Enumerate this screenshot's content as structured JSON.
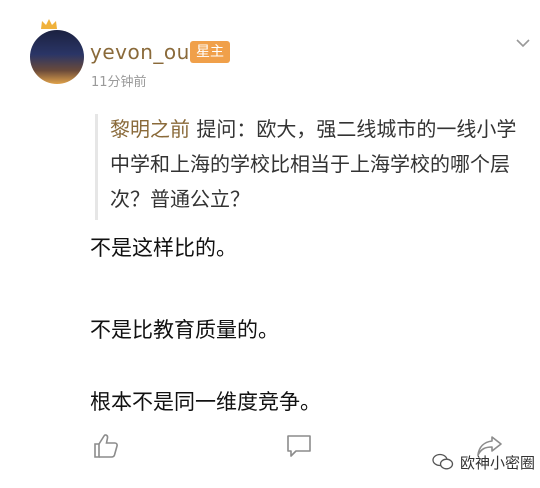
{
  "author": {
    "username": "yevon_ou",
    "badge": "星主",
    "timestamp": "11分钟前"
  },
  "quote": {
    "author": "黎明之前",
    "text": " 提问：欧大，强二线城市的一线小学中学和上海的学校比相当于上海学校的哪个层次？普通公立？"
  },
  "reply": {
    "lines": [
      "不是这样比的。",
      "不是比教育质量的。",
      "根本不是同一维度竞争。"
    ]
  },
  "watermark": {
    "label": "欧神小密圈"
  },
  "icons": {
    "crown": "crown-icon",
    "expand": "chevron-down-icon",
    "like": "thumbs-up-icon",
    "comment": "comment-icon",
    "share": "share-icon",
    "wechat": "wechat-icon"
  },
  "colors": {
    "username": "#8a6a3a",
    "badge_bg": "#f0a04a",
    "timestamp": "#9a9a9a",
    "icon": "#8c8c8c"
  }
}
